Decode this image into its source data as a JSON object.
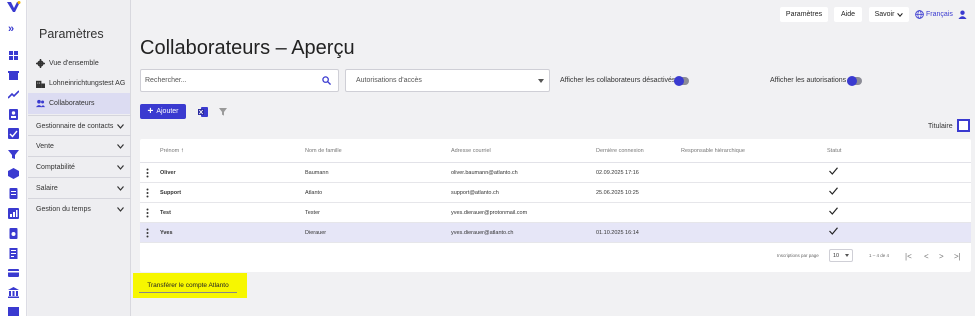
{
  "colors": {
    "accent": "#3a3ad0",
    "highlight": "#f7f700",
    "selected_row": "#e6e6f7"
  },
  "rail_icons": [
    "logo-icon",
    "expand-icon",
    "dashboard-icon",
    "shop-icon",
    "trend-icon",
    "contacts-icon",
    "tasks-icon",
    "filter-icon",
    "box-icon",
    "document-icon",
    "chart-icon",
    "invoice-icon",
    "receipt-icon",
    "card-icon",
    "bank-icon",
    "tag-icon"
  ],
  "sidebar": {
    "title": "Paramètres",
    "items": [
      {
        "label": "Vue d'ensemble",
        "icon": "gear-icon"
      },
      {
        "label": "Lohneinrichtungstest AG",
        "icon": "company-icon"
      },
      {
        "label": "Collaborateurs",
        "icon": "people-icon",
        "active": true
      }
    ],
    "groups": [
      "Gestionnaire de contacts",
      "Vente",
      "Comptabilité",
      "Salaire",
      "Gestion du temps"
    ]
  },
  "topbar": {
    "settings": "Paramètres",
    "help": "Aide",
    "knowledge": "Savoir",
    "language": "Français"
  },
  "page": {
    "title": "Collaborateurs – Aperçu",
    "search_placeholder": "Rechercher...",
    "permissions_select": "Autorisations d'accès",
    "toggle_deactivated": "Afficher les collaborateurs désactivés",
    "toggle_permissions": "Afficher les autorisations",
    "add_button": "Ajouter",
    "titulaire_label": "Titulaire"
  },
  "table": {
    "headers": [
      "Prénom",
      "Nom de famille",
      "Adresse courriel",
      "Dernière connexion",
      "Responsable hiérarchique",
      "Statut"
    ],
    "rows": [
      {
        "first": "Oliver",
        "last": "Baumann",
        "email": "oliver.baumann@atlanto.ch",
        "last_login": "02.09.2025 17:16",
        "manager": "",
        "status_check": true
      },
      {
        "first": "Support",
        "last": "Atlanto",
        "email": "support@atlanto.ch",
        "last_login": "25.06.2025 10:25",
        "manager": "",
        "status_check": true
      },
      {
        "first": "Test",
        "last": "Tester",
        "email": "yves.dierauer@protonmail.com",
        "last_login": "",
        "manager": "",
        "status_check": true
      },
      {
        "first": "Yves",
        "last": "Dierauer",
        "email": "yves.dierauer@atlanto.ch",
        "last_login": "01.10.2025 16:14",
        "manager": "",
        "status_check": true,
        "selected": true
      }
    ],
    "pagination": {
      "per_page_label": "Inscriptions par page",
      "per_page": "10",
      "range": "1 – 4 de 4"
    }
  },
  "transfer_button": "Transférer le compte Atlanto"
}
